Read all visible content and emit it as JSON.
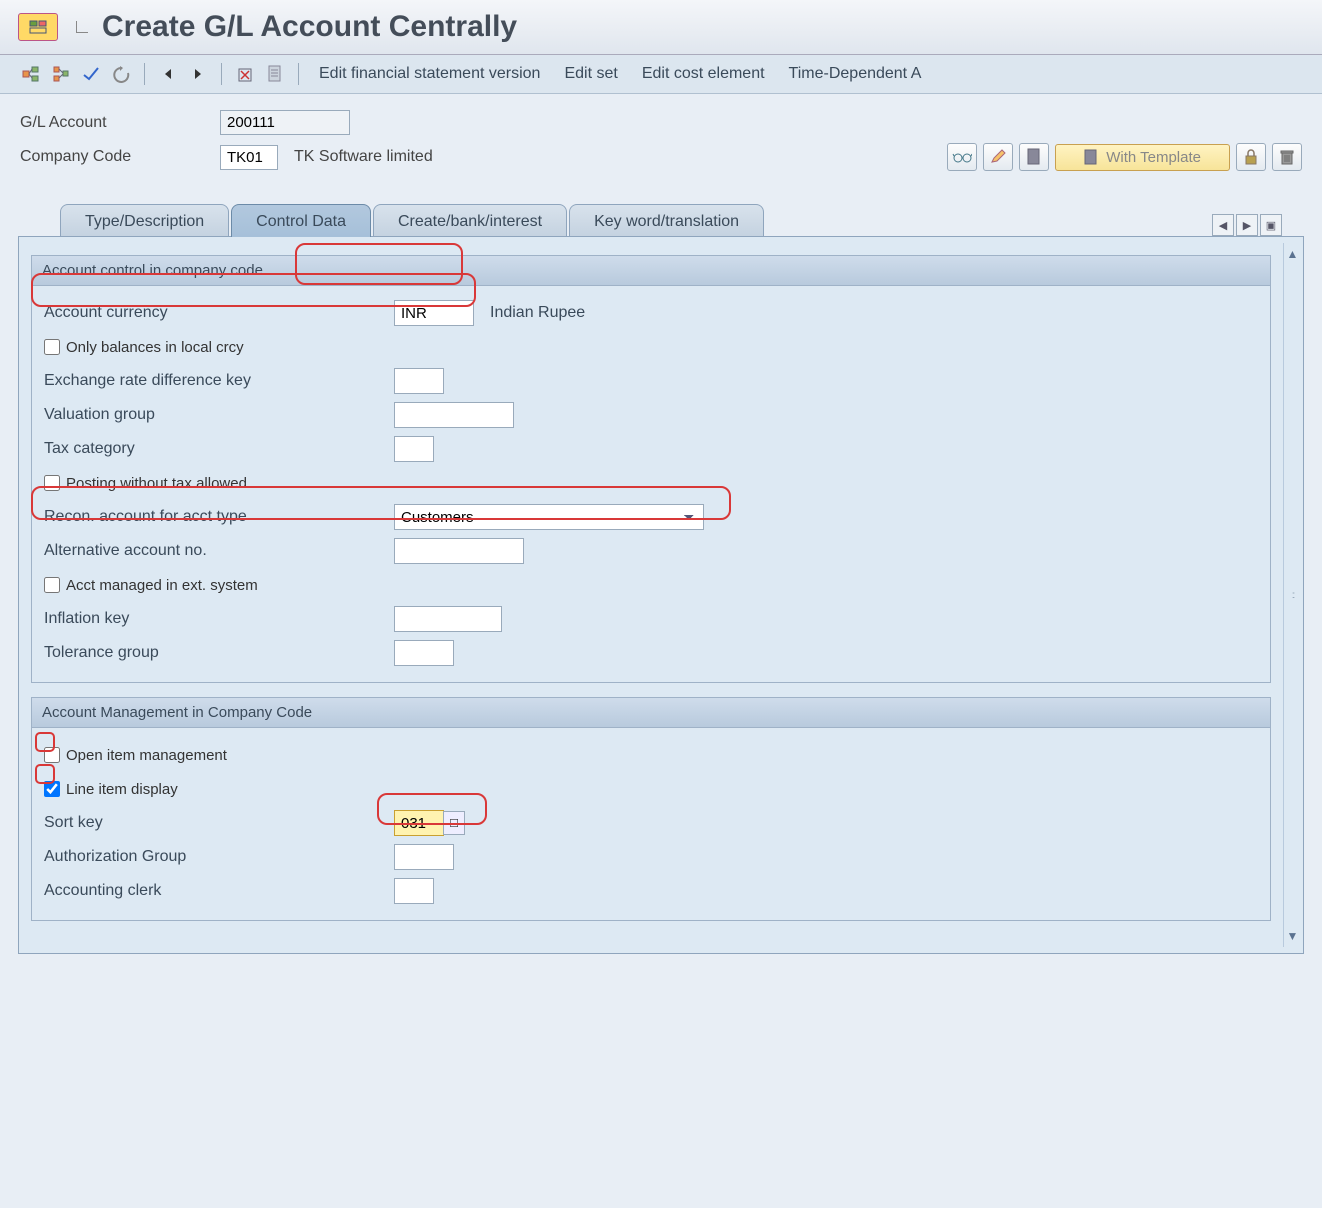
{
  "title": "Create G/L Account Centrally",
  "toolbar": {
    "text_items": [
      "Edit financial statement version",
      "Edit set",
      "Edit cost element",
      "Time-Dependent A"
    ]
  },
  "header": {
    "gl_account_label": "G/L Account",
    "gl_account_value": "200111",
    "company_code_label": "Company Code",
    "company_code_value": "TK01",
    "company_code_desc": "TK Software limited",
    "with_template_label": "With Template"
  },
  "tabs": {
    "t0": "Type/Description",
    "t1": "Control Data",
    "t2": "Create/bank/interest",
    "t3": "Key word/translation"
  },
  "section1": {
    "title": "Account control in company code",
    "account_currency_label": "Account currency",
    "account_currency_value": "INR",
    "account_currency_desc": "Indian Rupee",
    "only_balances_label": "Only balances in local crcy",
    "exchange_rate_label": "Exchange rate difference key",
    "valuation_group_label": "Valuation group",
    "tax_category_label": "Tax category",
    "posting_without_tax_label": "Posting without tax allowed",
    "recon_account_label": "Recon. account for acct type",
    "recon_account_value": "Customers",
    "alternative_account_label": "Alternative account no.",
    "acct_managed_ext_label": "Acct managed in ext. system",
    "inflation_key_label": "Inflation key",
    "tolerance_group_label": "Tolerance group"
  },
  "section2": {
    "title": "Account Management in Company Code",
    "open_item_label": "Open item management",
    "line_item_label": "Line item display",
    "sort_key_label": "Sort key",
    "sort_key_value": "031",
    "auth_group_label": "Authorization Group",
    "accounting_clerk_label": "Accounting clerk"
  }
}
